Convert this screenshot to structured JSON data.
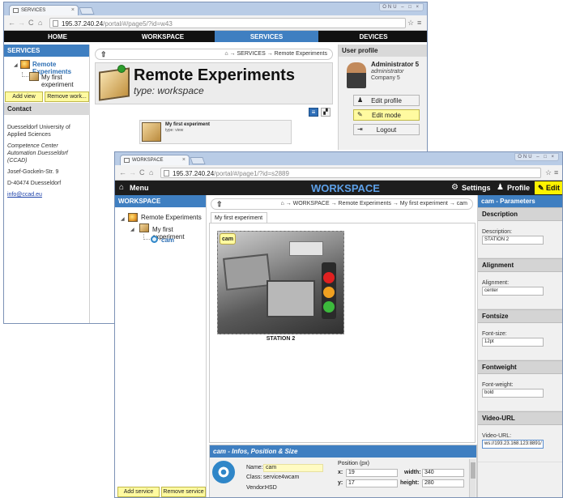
{
  "window1": {
    "tab_title": "SERVICES",
    "tab_close": "×",
    "url_host": "195.37.240.24",
    "url_path": "/portal/#/page5/?id=w43",
    "win_controls": "ONU  –  □  ×",
    "nav": [
      "HOME",
      "WORKSPACE",
      "SERVICES",
      "DEVICES"
    ],
    "left_header": "SERVICES",
    "tree": {
      "root": "Remote Experiments",
      "child": "My first experiment"
    },
    "buttons": {
      "add_view": "Add view",
      "remove": "Remove work..."
    },
    "contact_header": "Contact",
    "contact": {
      "line1": "Duesseldorf University of Applied Sciences",
      "line2": "Competence Center Automation Duesseldorf (CCAD)",
      "line3": "Josef-Gockeln-Str. 9",
      "line4": "D-40474 Duesseldorf",
      "email": "info@ccad.eu"
    },
    "breadcrumb": "→ SERVICES → Remote Experiments",
    "main_title": "Remote Experiments",
    "main_type": "type: workspace",
    "card_title": "My first experiment",
    "card_type": "type: view",
    "profile_header": "User profile",
    "profile": {
      "name": "Administrator 5",
      "role": "administrator",
      "company": "Company 5"
    },
    "profile_buttons": {
      "edit_profile": "Edit profile",
      "edit_mode": "Edit mode",
      "logout": "Logout"
    }
  },
  "window2": {
    "tab_title": "WORKSPACE",
    "tab_close": "×",
    "url_host": "195.37.240.24",
    "url_path": "/portal/#/page1/?id=s2889",
    "win_controls": "ONU  –  □  ×",
    "menu": "Menu",
    "title": "WORKSPACE",
    "settings": "Settings",
    "profile": "Profile",
    "edit": "Edit",
    "left_header": "WORKSPACE",
    "tree": {
      "root": "Remote Experiments",
      "child": "My first experiment",
      "leaf": "cam"
    },
    "buttons": {
      "add_service": "Add service",
      "remove_service": "Remove service"
    },
    "breadcrumb": "→ WORKSPACE → Remote Experiments → My first experiment → cam",
    "view_tab": "My first experiment",
    "cam_badge": "cam",
    "cam_caption": "STATION 2",
    "info_header": "cam - Infos, Position & Size",
    "info": {
      "name_label": "Name:",
      "name_value": "cam",
      "class_label": "Class:",
      "class_value": "service4wcam",
      "vendor_label": "Vendor:",
      "vendor_value": "HSD",
      "position_label": "Position (px)",
      "x_label": "x:",
      "x_value": "19",
      "y_label": "y:",
      "y_value": "17",
      "width_label": "width:",
      "width_value": "340",
      "height_label": "height:",
      "height_value": "280"
    },
    "params_header": "cam - Parameters",
    "params": [
      {
        "section": "Description",
        "label": "Description:",
        "value": "STATION 2"
      },
      {
        "section": "Alignment",
        "label": "Alignment:",
        "value": "center"
      },
      {
        "section": "Fontsize",
        "label": "Font-size:",
        "value": "12pt"
      },
      {
        "section": "Fontweight",
        "label": "Font-weight:",
        "value": "bold"
      },
      {
        "section": "Video-URL",
        "label": "Video-URL:",
        "value": "ws://193.23.168.123:8891/"
      }
    ]
  }
}
